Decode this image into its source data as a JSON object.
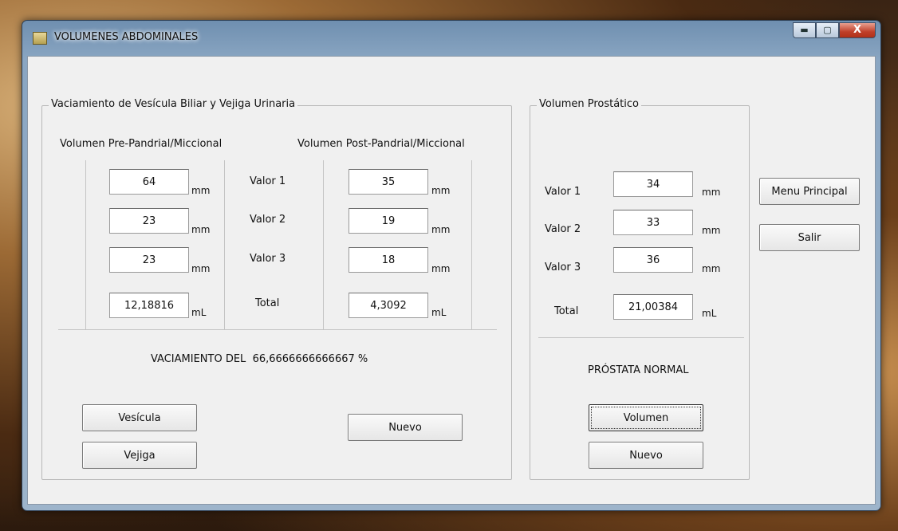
{
  "window": {
    "title": "VOLUMENES ABDOMINALES",
    "minimize": "▬",
    "maximize": "▢",
    "close": "X"
  },
  "left": {
    "title": "Vaciamiento de Vesícula Biliar y Vejiga Urinaria",
    "pre_header": "Volumen Pre-Pandrial/Miccional",
    "post_header": "Volumen Post-Pandrial/Miccional",
    "row_labels": [
      "Valor 1",
      "Valor 2",
      "Valor 3",
      "Total"
    ],
    "pre_values": [
      "64",
      "23",
      "23",
      "12,18816"
    ],
    "post_values": [
      "35",
      "19",
      "18",
      "4,3092"
    ],
    "unit_mm": "mm",
    "unit_ml": "mL",
    "result_prefix": "VACIAMIENTO DEL",
    "result_value": "66,6666666666667 %",
    "btn_vesicula": "Vesícula",
    "btn_vejiga": "Vejiga",
    "btn_nuevo": "Nuevo"
  },
  "right": {
    "title": "Volumen Prostático",
    "row_labels": [
      "Valor 1",
      "Valor 2",
      "Valor 3",
      "Total"
    ],
    "values": [
      "34",
      "33",
      "36",
      "21,00384"
    ],
    "unit_mm": "mm",
    "unit_ml": "mL",
    "result": "PRÓSTATA NORMAL",
    "btn_volumen": "Volumen",
    "btn_nuevo": "Nuevo"
  },
  "side": {
    "btn_menu": "Menu Principal",
    "btn_salir": "Salir"
  }
}
